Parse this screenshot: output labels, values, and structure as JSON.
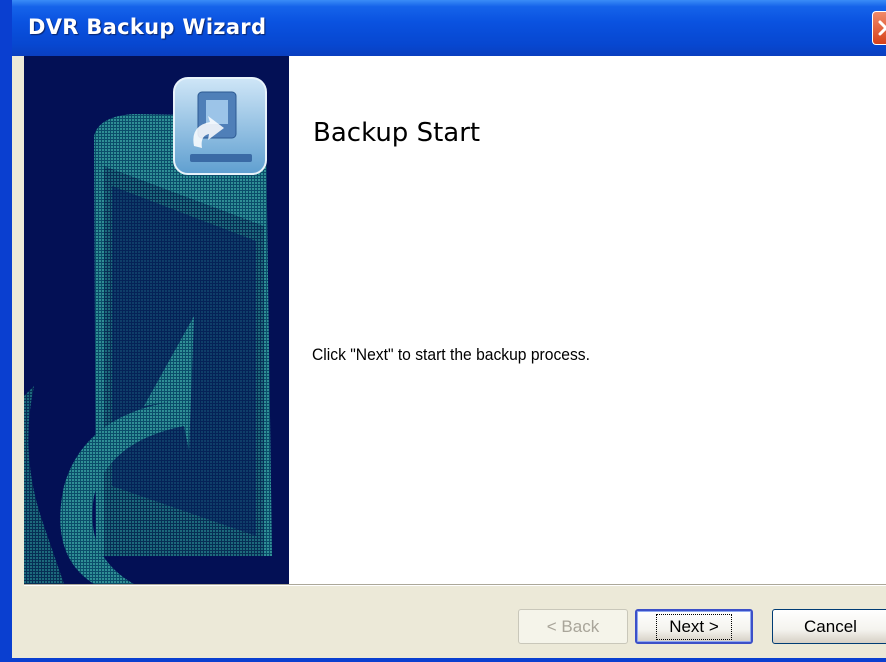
{
  "window": {
    "title": "DVR Backup Wizard",
    "close_icon": "close-icon"
  },
  "page": {
    "heading": "Backup Start",
    "instruction": "Click \"Next\" to start the backup process."
  },
  "buttons": {
    "back_label": "< Back",
    "next_label": "Next >",
    "cancel_label": "Cancel"
  },
  "colors": {
    "titlebar": "#0a52e0",
    "side_panel": "#031055",
    "side_pattern": "#2f8f95",
    "close_button": "#d6411a"
  }
}
